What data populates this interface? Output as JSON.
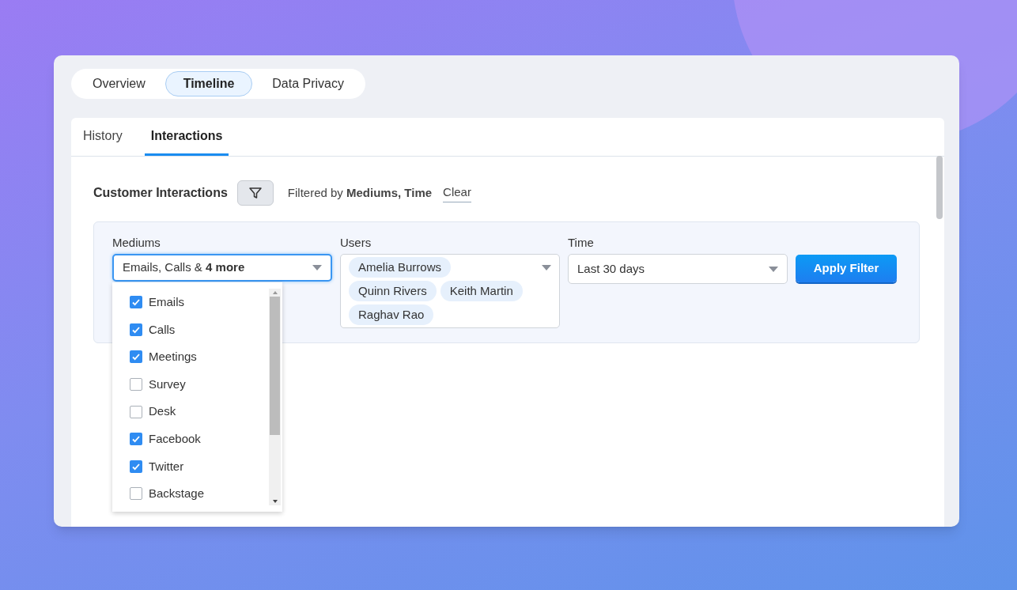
{
  "top_tabs": [
    {
      "label": "Overview",
      "selected": false
    },
    {
      "label": "Timeline",
      "selected": true
    },
    {
      "label": "Data Privacy",
      "selected": false
    }
  ],
  "sub_tabs": [
    {
      "label": "History",
      "selected": false
    },
    {
      "label": "Interactions",
      "selected": true
    }
  ],
  "header": {
    "title": "Customer Interactions",
    "filter_summary": "Filtered by **Mediums, Time**",
    "clear_link": "Clear"
  },
  "filters": {
    "mediums": {
      "label": "Mediums",
      "value": "Emails, Calls & **4 more**",
      "expanded": true,
      "options": [
        {
          "label": "Emails",
          "checked": true
        },
        {
          "label": "Calls",
          "checked": true
        },
        {
          "label": "Meetings",
          "checked": true
        },
        {
          "label": "Survey",
          "checked": false
        },
        {
          "label": "Desk",
          "checked": false
        },
        {
          "label": "Facebook",
          "checked": true
        },
        {
          "label": "Twitter",
          "checked": true
        },
        {
          "label": "Backstage",
          "checked": false
        }
      ]
    },
    "users": {
      "label": "Users",
      "chips": [
        "Amelia Burrows",
        "Quinn Rivers",
        "Keith Martin",
        "Raghav Rao"
      ]
    },
    "time": {
      "label": "Time",
      "value": "Last 30 days"
    },
    "apply_button": "Apply Filter"
  }
}
